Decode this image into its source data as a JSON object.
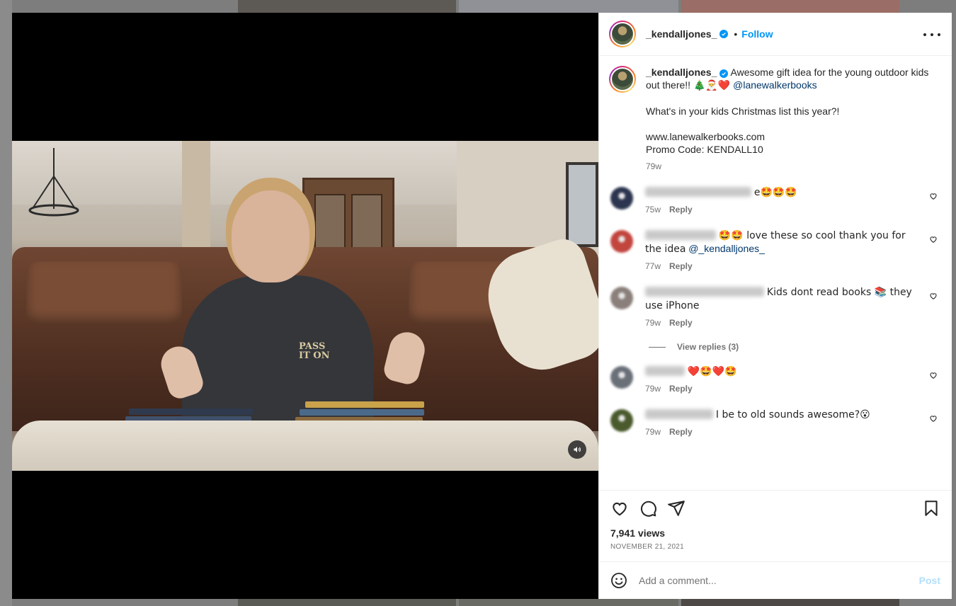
{
  "post": {
    "username": "_kendalljones_",
    "follow_label": "Follow",
    "separator": "•",
    "caption": {
      "line1": "Awesome gift idea for the young outdoor kids out there!!",
      "emojis": "🎄🎅❤️",
      "mention": "@lanewalkerbooks",
      "line2": "What's in your kids Christmas list this year?!",
      "website": "www.lanewalkerbooks.com",
      "promo": "Promo Code: KENDALL10",
      "time": "79w"
    },
    "views": "7,941 views",
    "date": "NOVEMBER 21, 2021"
  },
  "comments": [
    {
      "name_blur_width": 150,
      "text": "e🤩🤩🤩",
      "time": "75w",
      "reply": "Reply",
      "avatar_color": "#2c3550"
    },
    {
      "name_blur_width": 100,
      "text": "🤩🤩 love these so cool thank you for the idea",
      "mention": "@_kendalljones_",
      "time": "77w",
      "reply": "Reply",
      "avatar_color": "#c2453e"
    },
    {
      "name_blur_width": 168,
      "text": "Kids dont read books 📚 they use iPhone",
      "time": "79w",
      "reply": "Reply",
      "avatar_color": "#8a7f7a"
    },
    {
      "name_blur_width": 56,
      "text": "❤️🤩❤️🤩",
      "time": "79w",
      "reply": "Reply",
      "avatar_color": "#6a7078"
    },
    {
      "name_blur_width": 96,
      "text": "I be to old sounds awesome?😮",
      "time": "79w",
      "reply": "Reply",
      "avatar_color": "#4a5a2c"
    }
  ],
  "view_replies": "View replies (3)",
  "comment_box": {
    "placeholder": "Add a comment...",
    "post_label": "Post"
  },
  "video": {
    "logo_line1": "PASS",
    "logo_line2": "IT ON"
  },
  "icons": {
    "like": "heart-icon",
    "comment": "comment-icon",
    "share": "share-icon",
    "save": "bookmark-icon",
    "more": "more-options-icon",
    "sound": "speaker-icon",
    "emoji": "emoji-icon"
  },
  "colors": {
    "accent": "#0095f6",
    "link": "#00376b",
    "muted": "#737373",
    "post_disabled": "#b2dffc"
  }
}
